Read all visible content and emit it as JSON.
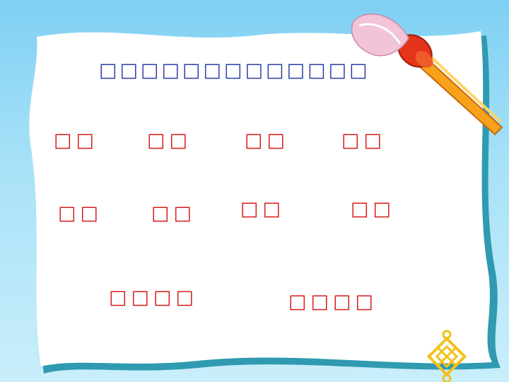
{
  "title": "□□□□□□□□□□□□□",
  "words": [
    "□□",
    "□□",
    "□□",
    "□□",
    "□□",
    "□□",
    "□□",
    "□□",
    "□□□□",
    "□□□□"
  ],
  "colors": {
    "title": "#2a3ea8",
    "words": "#d81a1a",
    "background": "#a9e2f8",
    "paper": "#ffffff",
    "paper_edge": "#2f9ab0",
    "brush_handle": "#f7a21a",
    "brush_ferrule": "#e5341a",
    "brush_bristles": "#f1c4d8",
    "knot": "#f2c21a"
  },
  "icons": [
    "paintbrush-icon",
    "endless-knot-icon"
  ]
}
